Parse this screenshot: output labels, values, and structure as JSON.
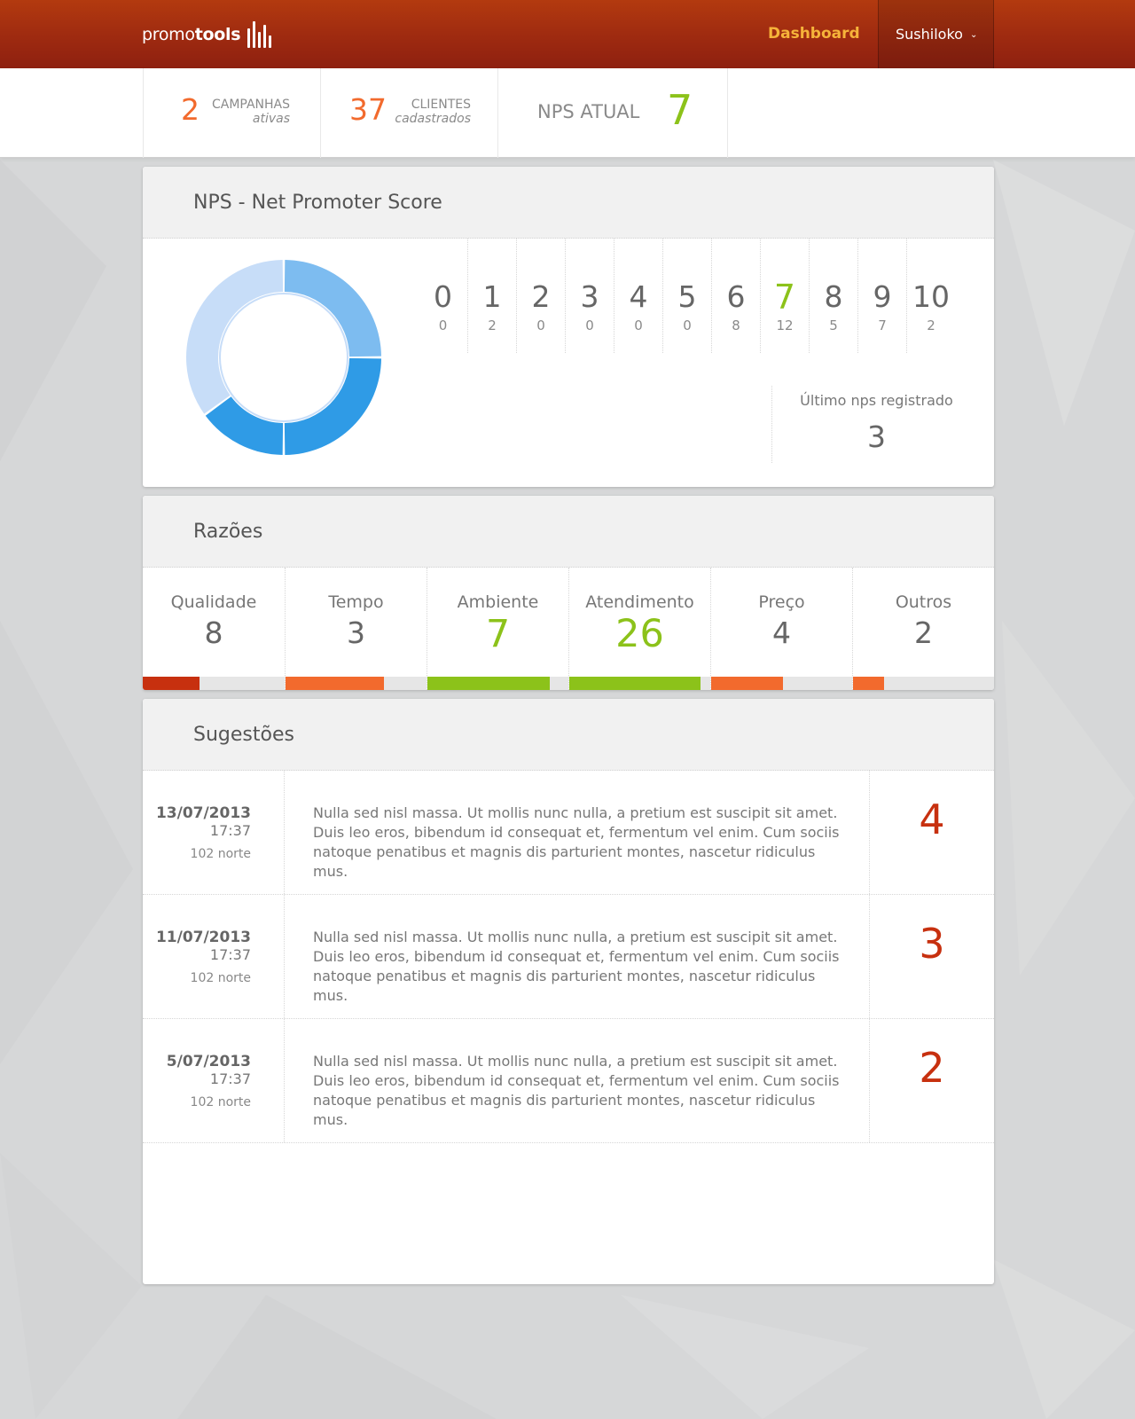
{
  "header": {
    "logo_regular": "promo",
    "logo_bold": "tools",
    "nav_dashboard": "Dashboard",
    "user_name": "Sushiloko"
  },
  "stats": {
    "campaigns": {
      "value": "2",
      "label": "CAMPANHAS",
      "sublabel": "ativas"
    },
    "clients": {
      "value": "37",
      "label": "CLIENTES",
      "sublabel": "cadastrados"
    },
    "nps": {
      "label": "NPS ATUAL",
      "value": "7"
    }
  },
  "nps_card": {
    "title": "NPS - Net Promoter Score",
    "scale": [
      {
        "score": "0",
        "count": "0"
      },
      {
        "score": "1",
        "count": "2"
      },
      {
        "score": "2",
        "count": "0"
      },
      {
        "score": "3",
        "count": "0"
      },
      {
        "score": "4",
        "count": "0"
      },
      {
        "score": "5",
        "count": "0"
      },
      {
        "score": "6",
        "count": "8"
      },
      {
        "score": "7",
        "count": "12"
      },
      {
        "score": "8",
        "count": "5"
      },
      {
        "score": "9",
        "count": "7"
      },
      {
        "score": "10",
        "count": "2"
      }
    ],
    "highlighted_score": "7",
    "last_label": "Último nps registrado",
    "last_value": "3",
    "donut_segments": [
      {
        "fraction": 0.25,
        "color": "#7dbcf0"
      },
      {
        "fraction": 0.25,
        "color": "#2f9be6"
      },
      {
        "fraction": 0.15,
        "color": "#2f9be6"
      },
      {
        "fraction": 0.35,
        "color": "#c7ddf8"
      }
    ]
  },
  "reasons_card": {
    "title": "Razões",
    "items": [
      {
        "name": "Qualidade",
        "value": "8",
        "fill": 0.4,
        "color": "#c7300f",
        "highlight": false
      },
      {
        "name": "Tempo",
        "value": "3",
        "fill": 0.7,
        "color": "#f26a2d",
        "highlight": false
      },
      {
        "name": "Ambiente",
        "value": "7",
        "fill": 0.87,
        "color": "#8cc21a",
        "highlight": true
      },
      {
        "name": "Atendimento",
        "value": "26",
        "fill": 0.93,
        "color": "#8cc21a",
        "highlight": true
      },
      {
        "name": "Preço",
        "value": "4",
        "fill": 0.51,
        "color": "#f26a2d",
        "highlight": false
      },
      {
        "name": "Outros",
        "value": "2",
        "fill": 0.22,
        "color": "#f26a2d",
        "highlight": false
      }
    ]
  },
  "suggestions_card": {
    "title": "Sugestões",
    "rows": [
      {
        "date": "13/07/2013",
        "time": "17:37",
        "location": "102 norte",
        "text": "Nulla sed nisl massa. Ut mollis nunc nulla, a pretium est suscipit sit amet. Duis leo eros, bibendum id consequat et, fermentum vel enim. Cum sociis natoque penatibus et magnis dis parturient montes, nascetur ridiculus mus.",
        "score": "4"
      },
      {
        "date": "11/07/2013",
        "time": "17:37",
        "location": "102 norte",
        "text": "Nulla sed nisl massa. Ut mollis nunc nulla, a pretium est suscipit sit amet. Duis leo eros, bibendum id consequat et, fermentum vel enim. Cum sociis natoque penatibus et magnis dis parturient montes, nascetur ridiculus mus.",
        "score": "3"
      },
      {
        "date": "5/07/2013",
        "time": "17:37",
        "location": "102 norte",
        "text": "Nulla sed nisl massa. Ut mollis nunc nulla, a pretium est suscipit sit amet. Duis leo eros, bibendum id consequat et, fermentum vel enim. Cum sociis natoque penatibus et magnis dis parturient montes, nascetur ridiculus mus.",
        "score": "2"
      }
    ]
  }
}
